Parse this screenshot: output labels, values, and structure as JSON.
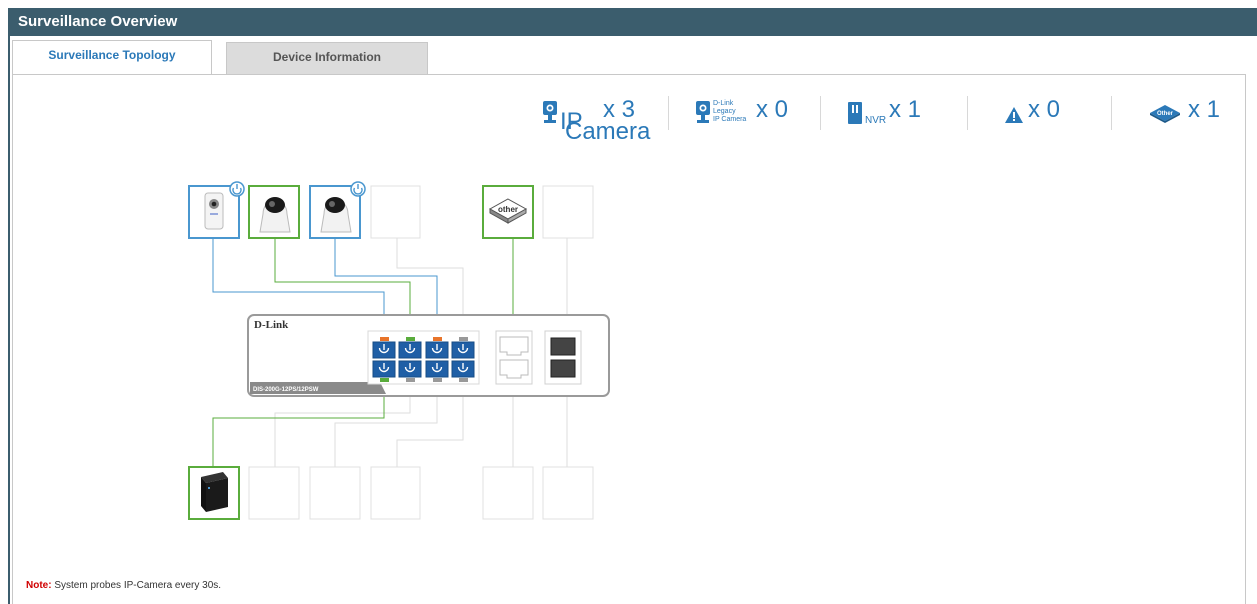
{
  "window": {
    "title": "Surveillance Overview"
  },
  "tabs": [
    {
      "label": "Surveillance Topology",
      "active": true
    },
    {
      "label": "Device Information",
      "active": false
    }
  ],
  "stats": {
    "ip_camera": {
      "label_top": "IP",
      "label_bottom": "Camera",
      "count": "x 3"
    },
    "legacy_camera": {
      "label_lines": [
        "D-Link",
        "Legacy",
        "IP Camera"
      ],
      "count": "x 0"
    },
    "nvr": {
      "label": "NVR",
      "count": "x 1"
    },
    "warning": {
      "count": "x 0"
    },
    "other": {
      "label": "Other",
      "count": "x 1"
    }
  },
  "switch": {
    "brand": "D-Link",
    "model": "DIS-200G-12PS/12PSW"
  },
  "topology": {
    "top_slots": [
      "ip-camera-cube",
      "ptz-camera",
      "ptz-camera",
      "empty",
      "other-device",
      "empty"
    ],
    "bottom_slots": [
      "nvr",
      "empty",
      "empty",
      "empty",
      "empty",
      "empty"
    ],
    "other_badge": "other"
  },
  "note": {
    "label": "Note:",
    "text": " System probes IP-Camera every 30s."
  },
  "colors": {
    "accent": "#2b79b8",
    "header": "#3b5d6d",
    "green": "#5aac3c",
    "orange": "#e8742a"
  }
}
